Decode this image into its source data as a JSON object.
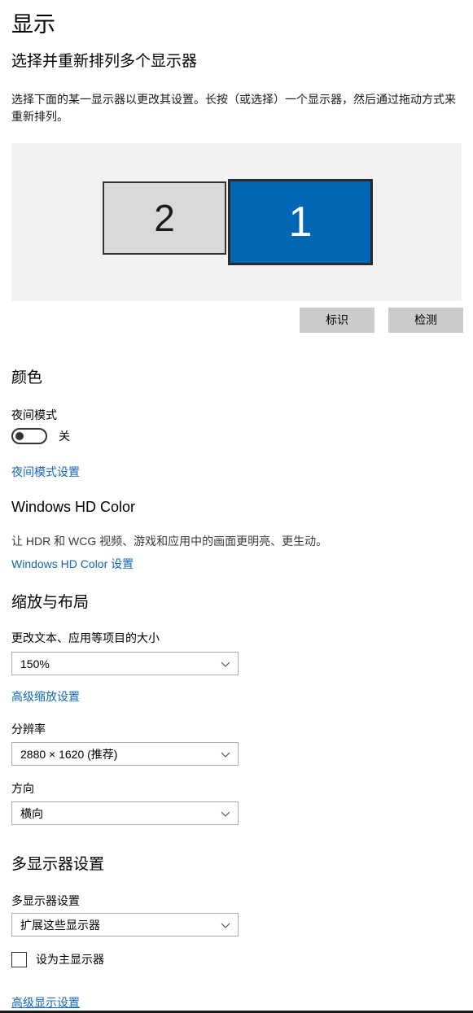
{
  "page": {
    "title": "显示"
  },
  "arrange": {
    "heading": "选择并重新排列多个显示器",
    "description": "选择下面的某一显示器以更改其设置。长按（或选择）一个显示器，然后通过拖动方式来重新排列。",
    "monitors": [
      {
        "number": "2",
        "selected": false
      },
      {
        "number": "1",
        "selected": true
      }
    ],
    "identify_button": "标识",
    "detect_button": "检测",
    "selected_color": "#0166b3",
    "unselected_color": "#d9d9d9",
    "panel_background": "#f2f2f2"
  },
  "color": {
    "heading": "颜色",
    "night_light_label": "夜间模式",
    "night_light_state": "关",
    "night_light_on": false,
    "night_light_settings_link": "夜间模式设置"
  },
  "hdr": {
    "heading": "Windows HD Color",
    "description": "让 HDR 和 WCG 视频、游戏和应用中的画面更明亮、更生动。",
    "settings_link": "Windows HD Color 设置"
  },
  "scale_layout": {
    "heading": "缩放与布局",
    "scale_label": "更改文本、应用等项目的大小",
    "scale_value": "150%",
    "advanced_scaling_link": "高级缩放设置",
    "resolution_label": "分辨率",
    "resolution_value": "2880 × 1620 (推荐)",
    "orientation_label": "方向",
    "orientation_value": "横向"
  },
  "multi_display": {
    "heading": "多显示器设置",
    "mode_label": "多显示器设置",
    "mode_value": "扩展这些显示器",
    "make_main_label": "设为主显示器",
    "make_main_checked": false,
    "advanced_display_link": "高级显示设置"
  },
  "colors": {
    "link": "#1267b5",
    "accent": "#0166b3"
  }
}
